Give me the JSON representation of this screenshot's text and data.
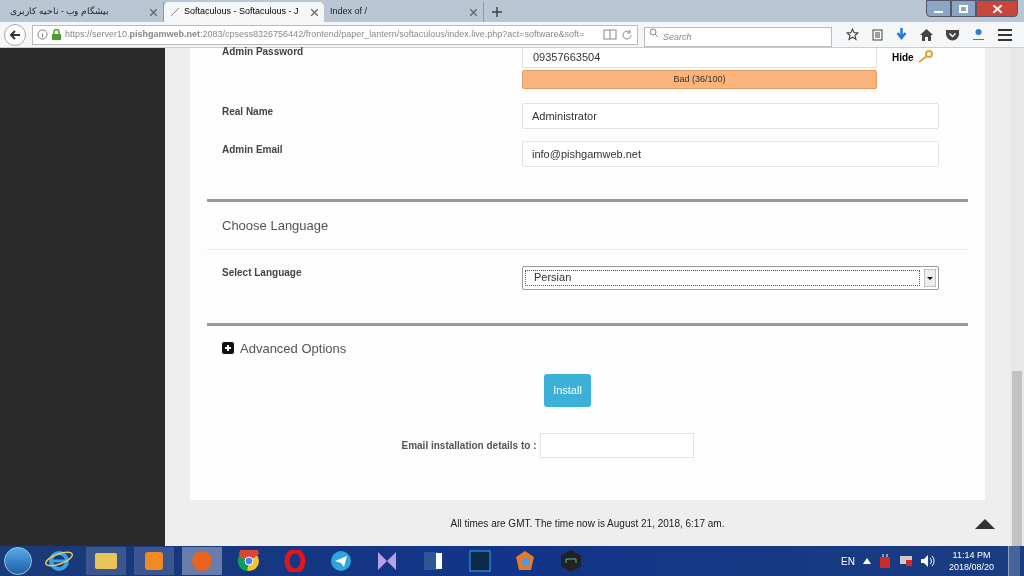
{
  "browser": {
    "tabs": [
      {
        "label": "بیشگام وب - ناحیه کاربری",
        "selected": false
      },
      {
        "label": "Softaculous - Softaculous - J",
        "selected": true
      },
      {
        "label": "Index of /",
        "selected": false
      }
    ],
    "url": "https://server10.**pishgamweb.net**:2083/cpsess8326756442/frontend/paper_lantern/softaculous/index.live.php?act=software&soft=",
    "search": {
      "placeholder": "Search"
    }
  },
  "password": {
    "label": "Admin Password",
    "value": "09357663504",
    "strength": "Bad (36/100)",
    "toggle": "Hide"
  },
  "fields": [
    {
      "label": "Real Name",
      "value": "Administrator"
    },
    {
      "label": "Admin Email",
      "value": "info@pishgamweb.net"
    }
  ],
  "language": {
    "heading": "Choose Language",
    "label": "Select Language",
    "value": "Persian"
  },
  "advanced": {
    "label": "Advanced Options",
    "expanded": false
  },
  "install_button": "Install",
  "email_details": {
    "label": "Email installation details to :"
  },
  "footer": "All times are GMT. The time now is August 21, 2018, 6:17 am.",
  "taskbar": {
    "language": "EN",
    "time": "11:14 PM",
    "date": "2018/08/20"
  }
}
